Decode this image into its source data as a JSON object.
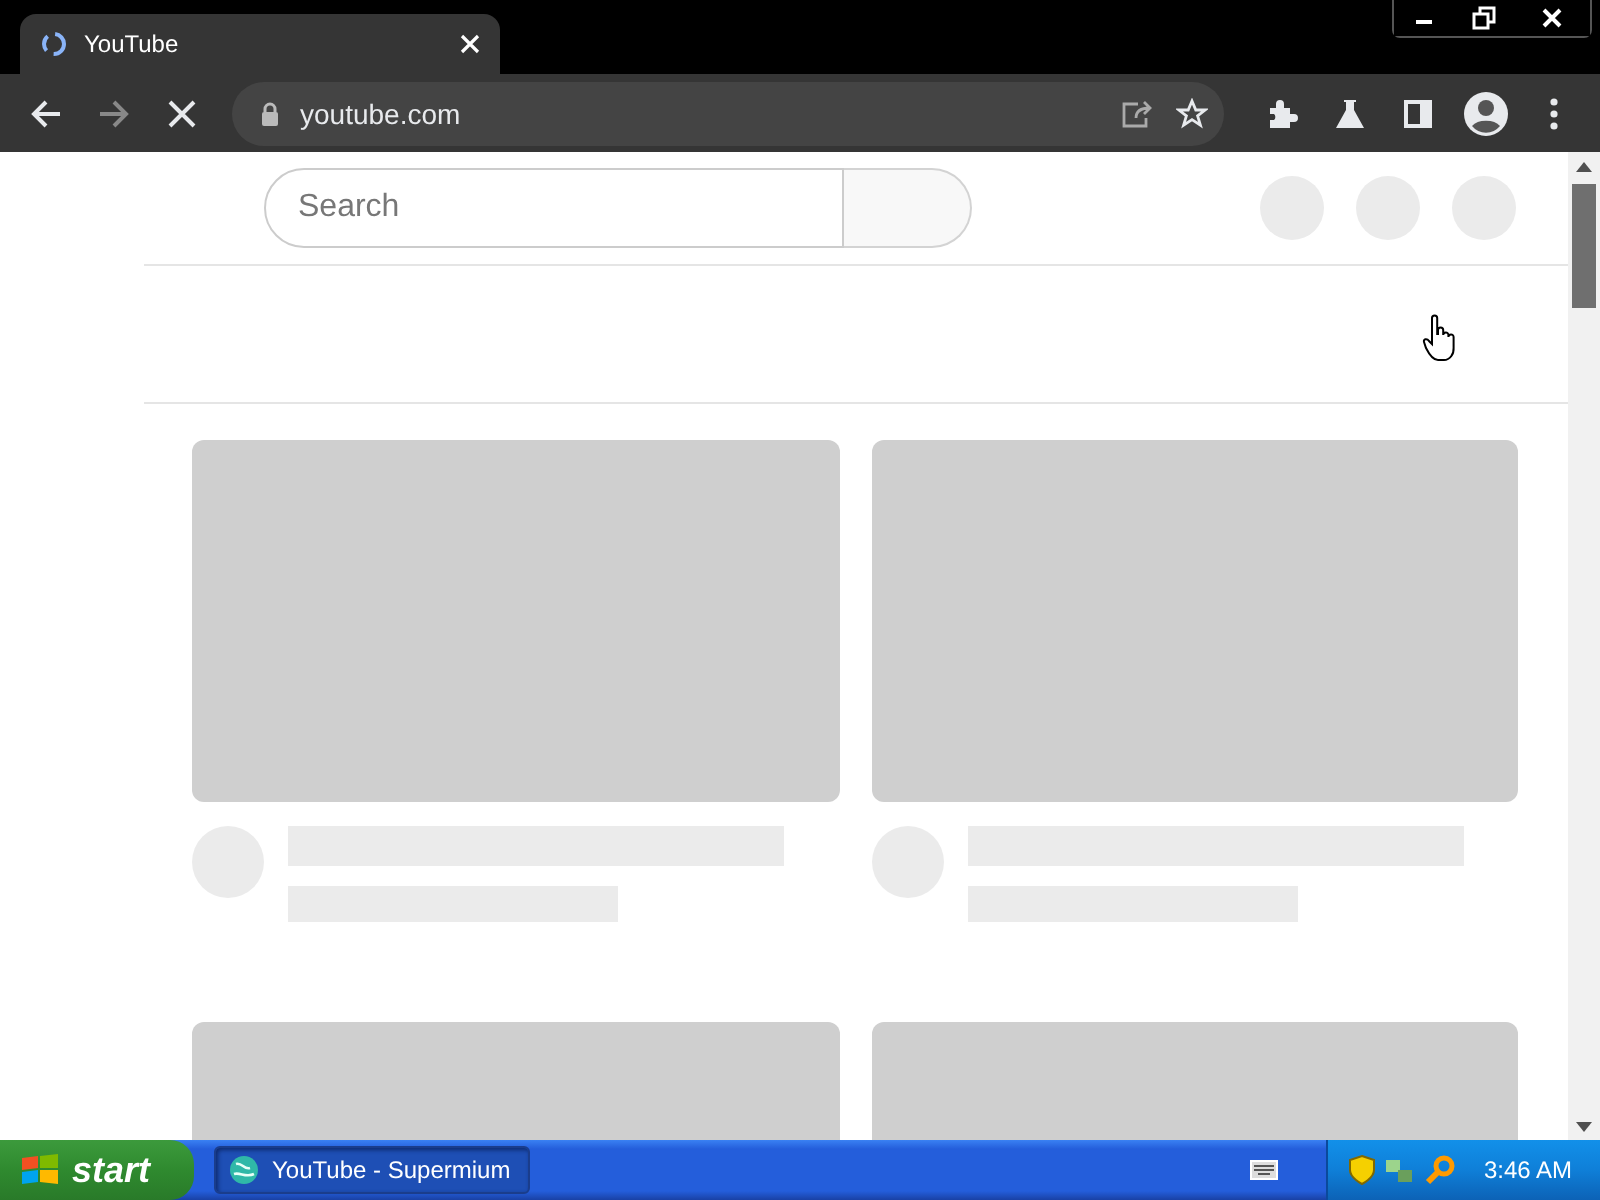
{
  "browser": {
    "tab": {
      "title": "YouTube",
      "selected": true
    },
    "back": {
      "disabled": false
    },
    "forward": {
      "disabled": true
    },
    "loading": true,
    "address": "youtube.com"
  },
  "page": {
    "search": {
      "placeholder": "Search"
    }
  },
  "taskbar": {
    "start": "start",
    "tasks": [
      {
        "label": "YouTube - Supermium",
        "selected": true
      }
    ],
    "clock": "3:46 AM"
  }
}
